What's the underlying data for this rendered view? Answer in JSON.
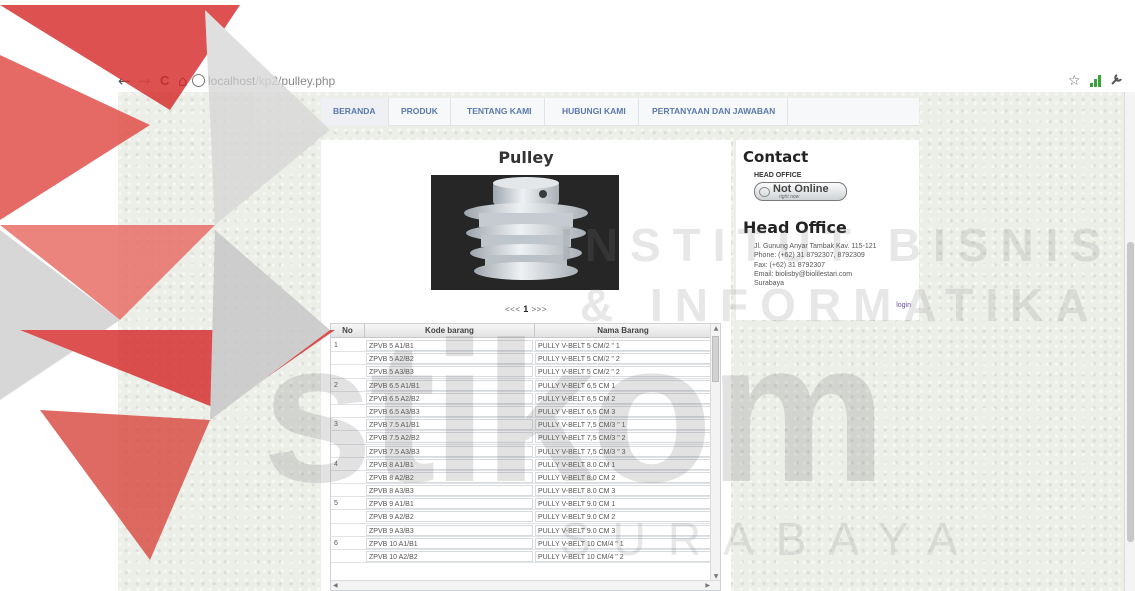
{
  "browser": {
    "back": "←",
    "forward": "→",
    "reload": "C",
    "home": "⌂",
    "url_host": "localhost",
    "url_path": "/kp2/pulley.php",
    "star": "☆",
    "wrench": "🔧"
  },
  "menu": {
    "items": [
      {
        "label": "BERANDA"
      },
      {
        "label": "PRODUK"
      },
      {
        "label": "TENTANG KAMI"
      },
      {
        "label": "HUBUNGI KAMI"
      },
      {
        "label": "PERTANYAAN DAN JAWABAN"
      }
    ]
  },
  "product": {
    "title": "Pulley",
    "pager_prev": "<<<",
    "pager_current": "1",
    "pager_next": ">>>"
  },
  "table": {
    "headers": [
      "No",
      "Kode barang",
      "Nama Barang"
    ],
    "rows": [
      {
        "no": "1",
        "kode": "ZPVB 5 A1/B1",
        "nama": "PULLY V-BELT 5 CM/2 \" 1"
      },
      {
        "no": "",
        "kode": "ZPVB 5 A2/B2",
        "nama": "PULLY V-BELT 5 CM/2 \" 2"
      },
      {
        "no": "",
        "kode": "ZPVB 5 A3/B3",
        "nama": "PULLY V-BELT 5 CM/2 \" 2"
      },
      {
        "no": "2",
        "kode": "ZPVB 6.5 A1/B1",
        "nama": "PULLY V-BELT 6,5 CM 1"
      },
      {
        "no": "",
        "kode": "ZPVB 6.5 A2/B2",
        "nama": "PULLY V-BELT 6,5 CM 2"
      },
      {
        "no": "",
        "kode": "ZPVB 6.5 A3/B3",
        "nama": "PULLY V-BELT 6,5 CM 3"
      },
      {
        "no": "3",
        "kode": "ZPVB 7.5 A1/B1",
        "nama": "PULLY V-BELT 7,5 CM/3 \" 1"
      },
      {
        "no": "",
        "kode": "ZPVB 7.5 A2/B2",
        "nama": "PULLY V-BELT 7,5 CM/3 \" 2"
      },
      {
        "no": "",
        "kode": "ZPVB 7.5 A3/B3",
        "nama": "PULLY V-BELT 7,5 CM/3 \" 3"
      },
      {
        "no": "4",
        "kode": "ZPVB 8 A1/B1",
        "nama": "PULLY V-BELT 8.0 CM 1"
      },
      {
        "no": "",
        "kode": "ZPVB 8 A2/B2",
        "nama": "PULLY V-BELT 8.0 CM 2"
      },
      {
        "no": "",
        "kode": "ZPVB 8 A3/B3",
        "nama": "PULLY V-BELT 8.0 CM 3"
      },
      {
        "no": "5",
        "kode": "ZPVB 9 A1/B1",
        "nama": "PULLY V-BELT 9.0 CM 1"
      },
      {
        "no": "",
        "kode": "ZPVB 9 A2/B2",
        "nama": "PULLY V-BELT 9.0 CM 2"
      },
      {
        "no": "",
        "kode": "ZPVB 9 A3/B3",
        "nama": "PULLY V-BELT 9.0 CM 3"
      },
      {
        "no": "6",
        "kode": "ZPVB 10 A1/B1",
        "nama": "PULLY V-BELT 10 CM/4 \" 1"
      },
      {
        "no": "",
        "kode": "ZPVB 10 A2/B2",
        "nama": "PULLY V-BELT 10 CM/4 \" 2"
      }
    ]
  },
  "sidebar": {
    "contact_title": "Contact",
    "head_office_label": "HEAD OFFICE",
    "status_big": "Not Online",
    "status_sub": "right now",
    "office_title": "Head Office",
    "address_lines": [
      "Jl. Gunung Anyar Tambak Kav. 115-121",
      "Phone: (+62) 31 8792307, 8792309",
      "Fax: (+62) 31 8792307",
      "Email: biolisby@biolilestari.com",
      "Surabaya"
    ],
    "login": "login"
  },
  "watermark": {
    "line1": "INSTITUT BISNIS",
    "line2": "& INFORMATIKA",
    "brand": "stikom",
    "city": "SURABAYA",
    "colors": [
      "#d62b2b",
      "#c9c9c9"
    ]
  }
}
